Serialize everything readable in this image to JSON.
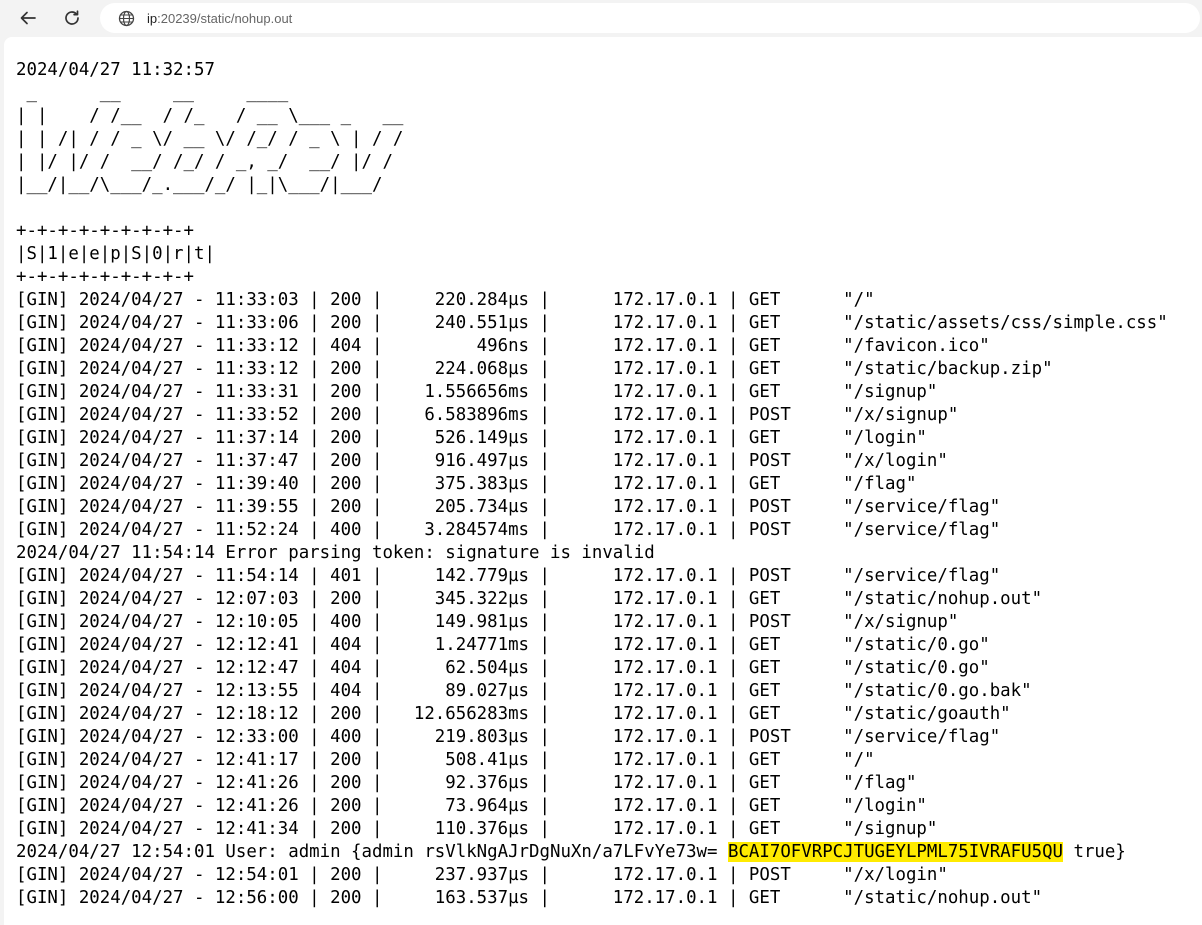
{
  "browser": {
    "url_host": "ip",
    "url_path": ":20239/static/nohup.out"
  },
  "log": {
    "start_line": "2024/04/27 11:32:57",
    "banner_ascii": [
      " _      __     __     ____",
      "| |    / /__  / /_   / __ \\___ _   __",
      "| | /| / / _ \\/ __ \\/ /_/ / _ \\ | / /",
      "| |/ |/ /  __/ /_/ / _, _/  __/ |/ /",
      "|__/|__/\\___/_.___/_/ |_|\\___/|___/"
    ],
    "blank_line": "",
    "tag_border": "+-+-+-+-+-+-+-+-+",
    "tag_text": "|S|1|e|e|p|S|0|r|t|",
    "requests_a": [
      "[GIN] 2024/04/27 - 11:33:03 | 200 |     220.284µs |      172.17.0.1 | GET      \"/\"",
      "[GIN] 2024/04/27 - 11:33:06 | 200 |     240.551µs |      172.17.0.1 | GET      \"/static/assets/css/simple.css\"",
      "[GIN] 2024/04/27 - 11:33:12 | 404 |         496ns |      172.17.0.1 | GET      \"/favicon.ico\"",
      "[GIN] 2024/04/27 - 11:33:12 | 200 |     224.068µs |      172.17.0.1 | GET      \"/static/backup.zip\"",
      "[GIN] 2024/04/27 - 11:33:31 | 200 |    1.556656ms |      172.17.0.1 | GET      \"/signup\"",
      "[GIN] 2024/04/27 - 11:33:52 | 200 |    6.583896ms |      172.17.0.1 | POST     \"/x/signup\"",
      "[GIN] 2024/04/27 - 11:37:14 | 200 |     526.149µs |      172.17.0.1 | GET      \"/login\"",
      "[GIN] 2024/04/27 - 11:37:47 | 200 |     916.497µs |      172.17.0.1 | POST     \"/x/login\"",
      "[GIN] 2024/04/27 - 11:39:40 | 200 |     375.383µs |      172.17.0.1 | GET      \"/flag\"",
      "[GIN] 2024/04/27 - 11:39:55 | 200 |     205.734µs |      172.17.0.1 | POST     \"/service/flag\"",
      "[GIN] 2024/04/27 - 11:52:24 | 400 |    3.284574ms |      172.17.0.1 | POST     \"/service/flag\""
    ],
    "error_line": "2024/04/27 11:54:14 Error parsing token: signature is invalid",
    "requests_b": [
      "[GIN] 2024/04/27 - 11:54:14 | 401 |     142.779µs |      172.17.0.1 | POST     \"/service/flag\"",
      "[GIN] 2024/04/27 - 12:07:03 | 200 |     345.322µs |      172.17.0.1 | GET      \"/static/nohup.out\"",
      "[GIN] 2024/04/27 - 12:10:05 | 400 |     149.981µs |      172.17.0.1 | POST     \"/x/signup\"",
      "[GIN] 2024/04/27 - 12:12:41 | 404 |     1.24771ms |      172.17.0.1 | GET      \"/static/0.go\"",
      "[GIN] 2024/04/27 - 12:12:47 | 404 |      62.504µs |      172.17.0.1 | GET      \"/static/0.go\"",
      "[GIN] 2024/04/27 - 12:13:55 | 404 |      89.027µs |      172.17.0.1 | GET      \"/static/0.go.bak\"",
      "[GIN] 2024/04/27 - 12:18:12 | 200 |   12.656283ms |      172.17.0.1 | GET      \"/static/goauth\"",
      "[GIN] 2024/04/27 - 12:33:00 | 400 |     219.803µs |      172.17.0.1 | POST     \"/service/flag\"",
      "[GIN] 2024/04/27 - 12:41:17 | 200 |      508.41µs |      172.17.0.1 | GET      \"/\"",
      "[GIN] 2024/04/27 - 12:41:26 | 200 |      92.376µs |      172.17.0.1 | GET      \"/flag\"",
      "[GIN] 2024/04/27 - 12:41:26 | 200 |      73.964µs |      172.17.0.1 | GET      \"/login\"",
      "[GIN] 2024/04/27 - 12:41:34 | 200 |     110.376µs |      172.17.0.1 | GET      \"/signup\""
    ],
    "user_line": {
      "prefix": "2024/04/27 12:54:01 User: admin {admin rsVlkNgAJrDgNuXn/a7LFvYe73w= ",
      "highlight": "BCAI7OFVRPCJTUGEYLPML75IVRAFU5QU",
      "suffix": " true}"
    },
    "requests_c": [
      "[GIN] 2024/04/27 - 12:54:01 | 200 |     237.937µs |      172.17.0.1 | POST     \"/x/login\"",
      "[GIN] 2024/04/27 - 12:56:00 | 200 |     163.537µs |      172.17.0.1 | GET      \"/static/nohup.out\""
    ]
  },
  "colors": {
    "highlight": "#ffeb00",
    "chrome_bg": "#f3f3f3",
    "page_bg": "#ffffff"
  },
  "icons": [
    "back-arrow-icon",
    "reload-icon",
    "globe-icon"
  ]
}
